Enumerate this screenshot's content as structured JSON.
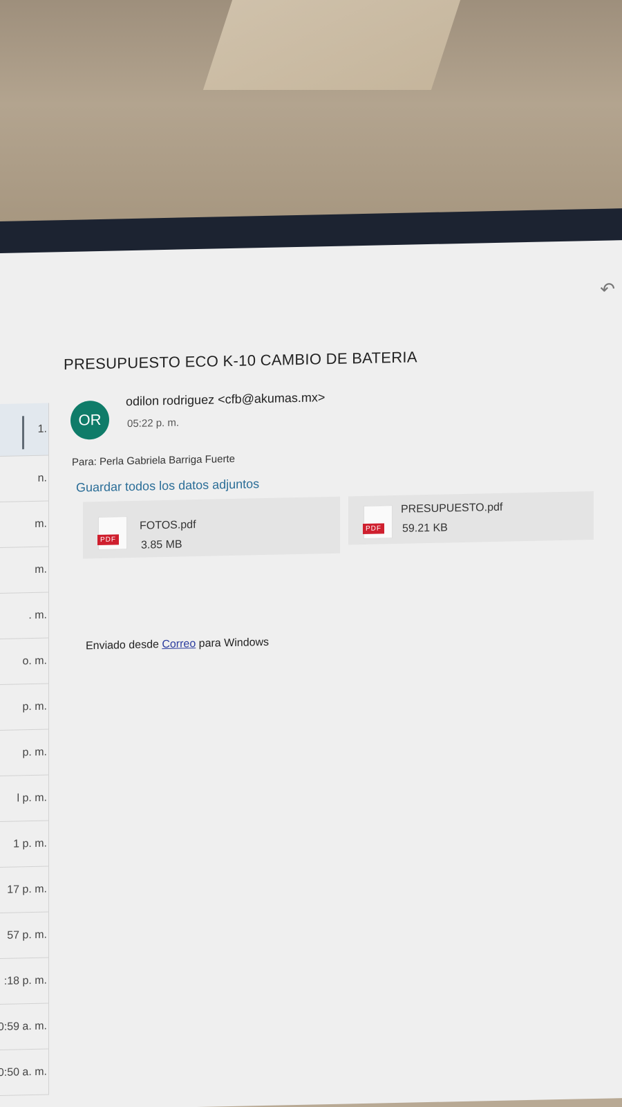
{
  "email": {
    "subject": "PRESUPUESTO ECO K-10 CAMBIO DE BATERIA",
    "sender": {
      "initials": "OR",
      "name_and_address": "odilon rodriguez <cfb@akumas.mx>",
      "time": "05:22 p. m.",
      "avatar_color": "#0f7c69"
    },
    "to_line": "Para: Perla Gabriela Barriga Fuerte",
    "save_all_label": "Guardar todos los datos adjuntos",
    "attachments": [
      {
        "icon": "pdf-icon",
        "icon_label": "PDF",
        "name": "FOTOS.pdf",
        "size": "3.85 MB"
      },
      {
        "icon": "pdf-icon",
        "icon_label": "PDF",
        "name": "PRESUPUESTO.pdf",
        "size": "59.21 KB"
      }
    ],
    "body": {
      "prefix": "Enviado desde ",
      "link": "Correo",
      "suffix": " para Windows"
    }
  },
  "toolbar": {
    "reply_icon": "↶"
  },
  "message_list_times": [
    "1.",
    "n.",
    "m.",
    "m.",
    ". m.",
    "o. m.",
    "p. m.",
    "p. m.",
    "l p. m.",
    "1 p. m.",
    "17 p. m.",
    "57 p. m.",
    ":18 p. m.",
    "0:59 a. m.",
    "0:50 a. m."
  ],
  "colors": {
    "link": "#2a6d97",
    "pdf_badge": "#cf1f2e"
  }
}
